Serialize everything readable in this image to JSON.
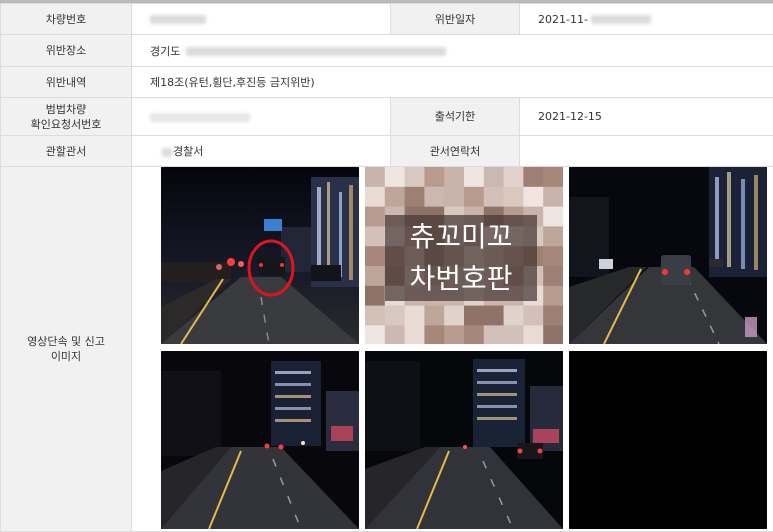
{
  "labels": {
    "vehicle_number": "차량번호",
    "violation_date": "위반일자",
    "violation_place": "위반장소",
    "violation_details": "위반내역",
    "request_number_l1": "범법차량",
    "request_number_l2": "확인요청서번호",
    "appearance_deadline": "출석기한",
    "jurisdiction": "관할관서",
    "office_contact": "관서연락처",
    "images_l1": "영상단속 및 신고",
    "images_l2": "이미지"
  },
  "values": {
    "violation_date": "2021-11-",
    "violation_place": "경기도",
    "violation_details": "제18조(유턴,횡단,후진등 금지위반)",
    "appearance_deadline": "2021-12-15",
    "jurisdiction": "경찰서",
    "office_contact": ""
  },
  "overlay": {
    "line1": "츄꼬미꼬",
    "line2": "차번호판"
  },
  "colors": {
    "label_bg": "#f1f1f1",
    "border": "#dcdcdc",
    "highlight_circle": "#e0141e"
  },
  "images": [
    {
      "icon": "dashcam-night-street-circled-car"
    },
    {
      "icon": "pixelated-license-plate"
    },
    {
      "icon": "dashcam-night-street-car-ahead"
    },
    {
      "icon": "dashcam-night-street"
    },
    {
      "icon": "dashcam-night-street"
    },
    {
      "icon": "black-frame"
    }
  ]
}
